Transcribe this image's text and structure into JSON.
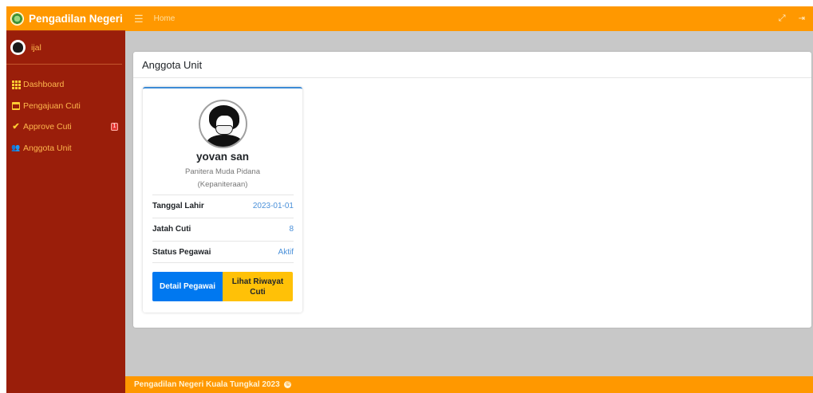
{
  "brand": {
    "title": "Pengadilan Negeri"
  },
  "user": {
    "name": "ijal"
  },
  "sidebar": {
    "items": [
      {
        "label": "Dashboard",
        "icon": "th-icon"
      },
      {
        "label": "Pengajuan Cuti",
        "icon": "calendar-icon"
      },
      {
        "label": "Approve Cuti",
        "icon": "check-icon",
        "badge": "1"
      },
      {
        "label": "Anggota Unit",
        "icon": "users-icon"
      }
    ]
  },
  "topbar": {
    "menu_icon": "hamburger-icon",
    "home_label": "Home",
    "right_icons": [
      "expand-icon",
      "logout-icon"
    ]
  },
  "card": {
    "title": "Anggota Unit"
  },
  "profile": {
    "name": "yovan san",
    "role": "Panitera Muda Pidana",
    "unit": "(Kepaniteraan)",
    "rows": [
      {
        "label": "Tanggal Lahir",
        "value": "2023-01-01"
      },
      {
        "label": "Jatah Cuti",
        "value": "8"
      },
      {
        "label": "Status Pegawai",
        "value": "Aktif"
      }
    ],
    "buttons": {
      "detail": "Detail Pegawai",
      "riwayat": "Lihat Riwayat Cuti"
    }
  },
  "footer": {
    "text": "Pengadilan Negeri Kuala Tungkal 2023",
    "copyright_symbol": "©"
  },
  "colors": {
    "sidebar": "#9a1e0a",
    "topbar": "#ff9800",
    "primary": "#0078f0",
    "warning": "#ffc107",
    "link": "#4a90d9"
  }
}
